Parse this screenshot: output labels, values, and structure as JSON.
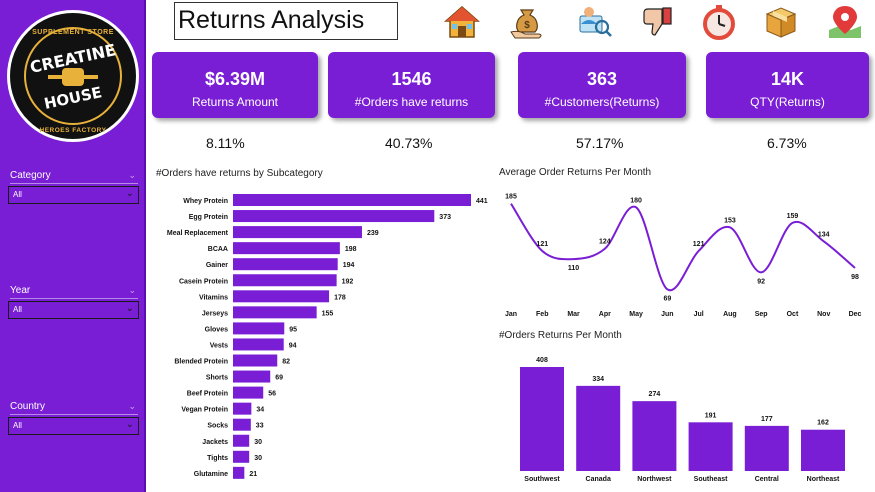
{
  "title": "Returns Analysis",
  "logo": {
    "top_text": "SUPPLEMENT STORE",
    "main_line1": "CREATINE",
    "main_line2": "HOUSE",
    "bottom_text": "HEROES FACTORY"
  },
  "filters": [
    {
      "label": "Category",
      "value": "All"
    },
    {
      "label": "Year",
      "value": "All"
    },
    {
      "label": "Country",
      "value": "All"
    }
  ],
  "icons": [
    "house-icon",
    "money-bag-icon",
    "customer-search-icon",
    "thumbs-down-icon",
    "stopwatch-icon",
    "box-icon",
    "map-pin-icon"
  ],
  "kpis": [
    {
      "value": "$6.39M",
      "label": "Returns Amount",
      "pct": "8.11%"
    },
    {
      "value": "1546",
      "label": "#Orders have returns",
      "pct": "40.73%"
    },
    {
      "value": "363",
      "label": "#Customers(Returns)",
      "pct": "57.17%"
    },
    {
      "value": "14K",
      "label": "QTY(Returns)",
      "pct": "6.73%"
    }
  ],
  "colors": {
    "accent": "#7a1ed6",
    "bar": "#7a1ed6",
    "line": "#7a1ed6"
  },
  "chart_data": [
    {
      "type": "bar",
      "orientation": "horizontal",
      "title": "#Orders have returns by Subcategory",
      "categories": [
        "Whey Protein",
        "Egg Protein",
        "Meal Replacement",
        "BCAA",
        "Gainer",
        "Casein Protein",
        "Vitamins",
        "Jerseys",
        "Gloves",
        "Vests",
        "Blended Protein",
        "Shorts",
        "Beef Protein",
        "Vegan Protein",
        "Socks",
        "Jackets",
        "Tights",
        "Glutamine"
      ],
      "values": [
        441,
        373,
        239,
        198,
        194,
        192,
        178,
        155,
        95,
        94,
        82,
        69,
        56,
        34,
        33,
        30,
        30,
        21
      ]
    },
    {
      "type": "line",
      "title": "Average Order Returns Per Month",
      "categories": [
        "Jan",
        "Feb",
        "Mar",
        "Apr",
        "May",
        "Jun",
        "Jul",
        "Aug",
        "Sep",
        "Oct",
        "Nov",
        "Dec"
      ],
      "values": [
        185,
        121,
        110,
        124,
        180,
        69,
        121,
        153,
        92,
        159,
        134,
        98
      ]
    },
    {
      "type": "bar",
      "title": "#Orders Returns Per Month",
      "categories": [
        "Southwest",
        "Canada",
        "Northwest",
        "Southeast",
        "Central",
        "Northeast"
      ],
      "values": [
        408,
        334,
        274,
        191,
        177,
        162
      ]
    }
  ]
}
